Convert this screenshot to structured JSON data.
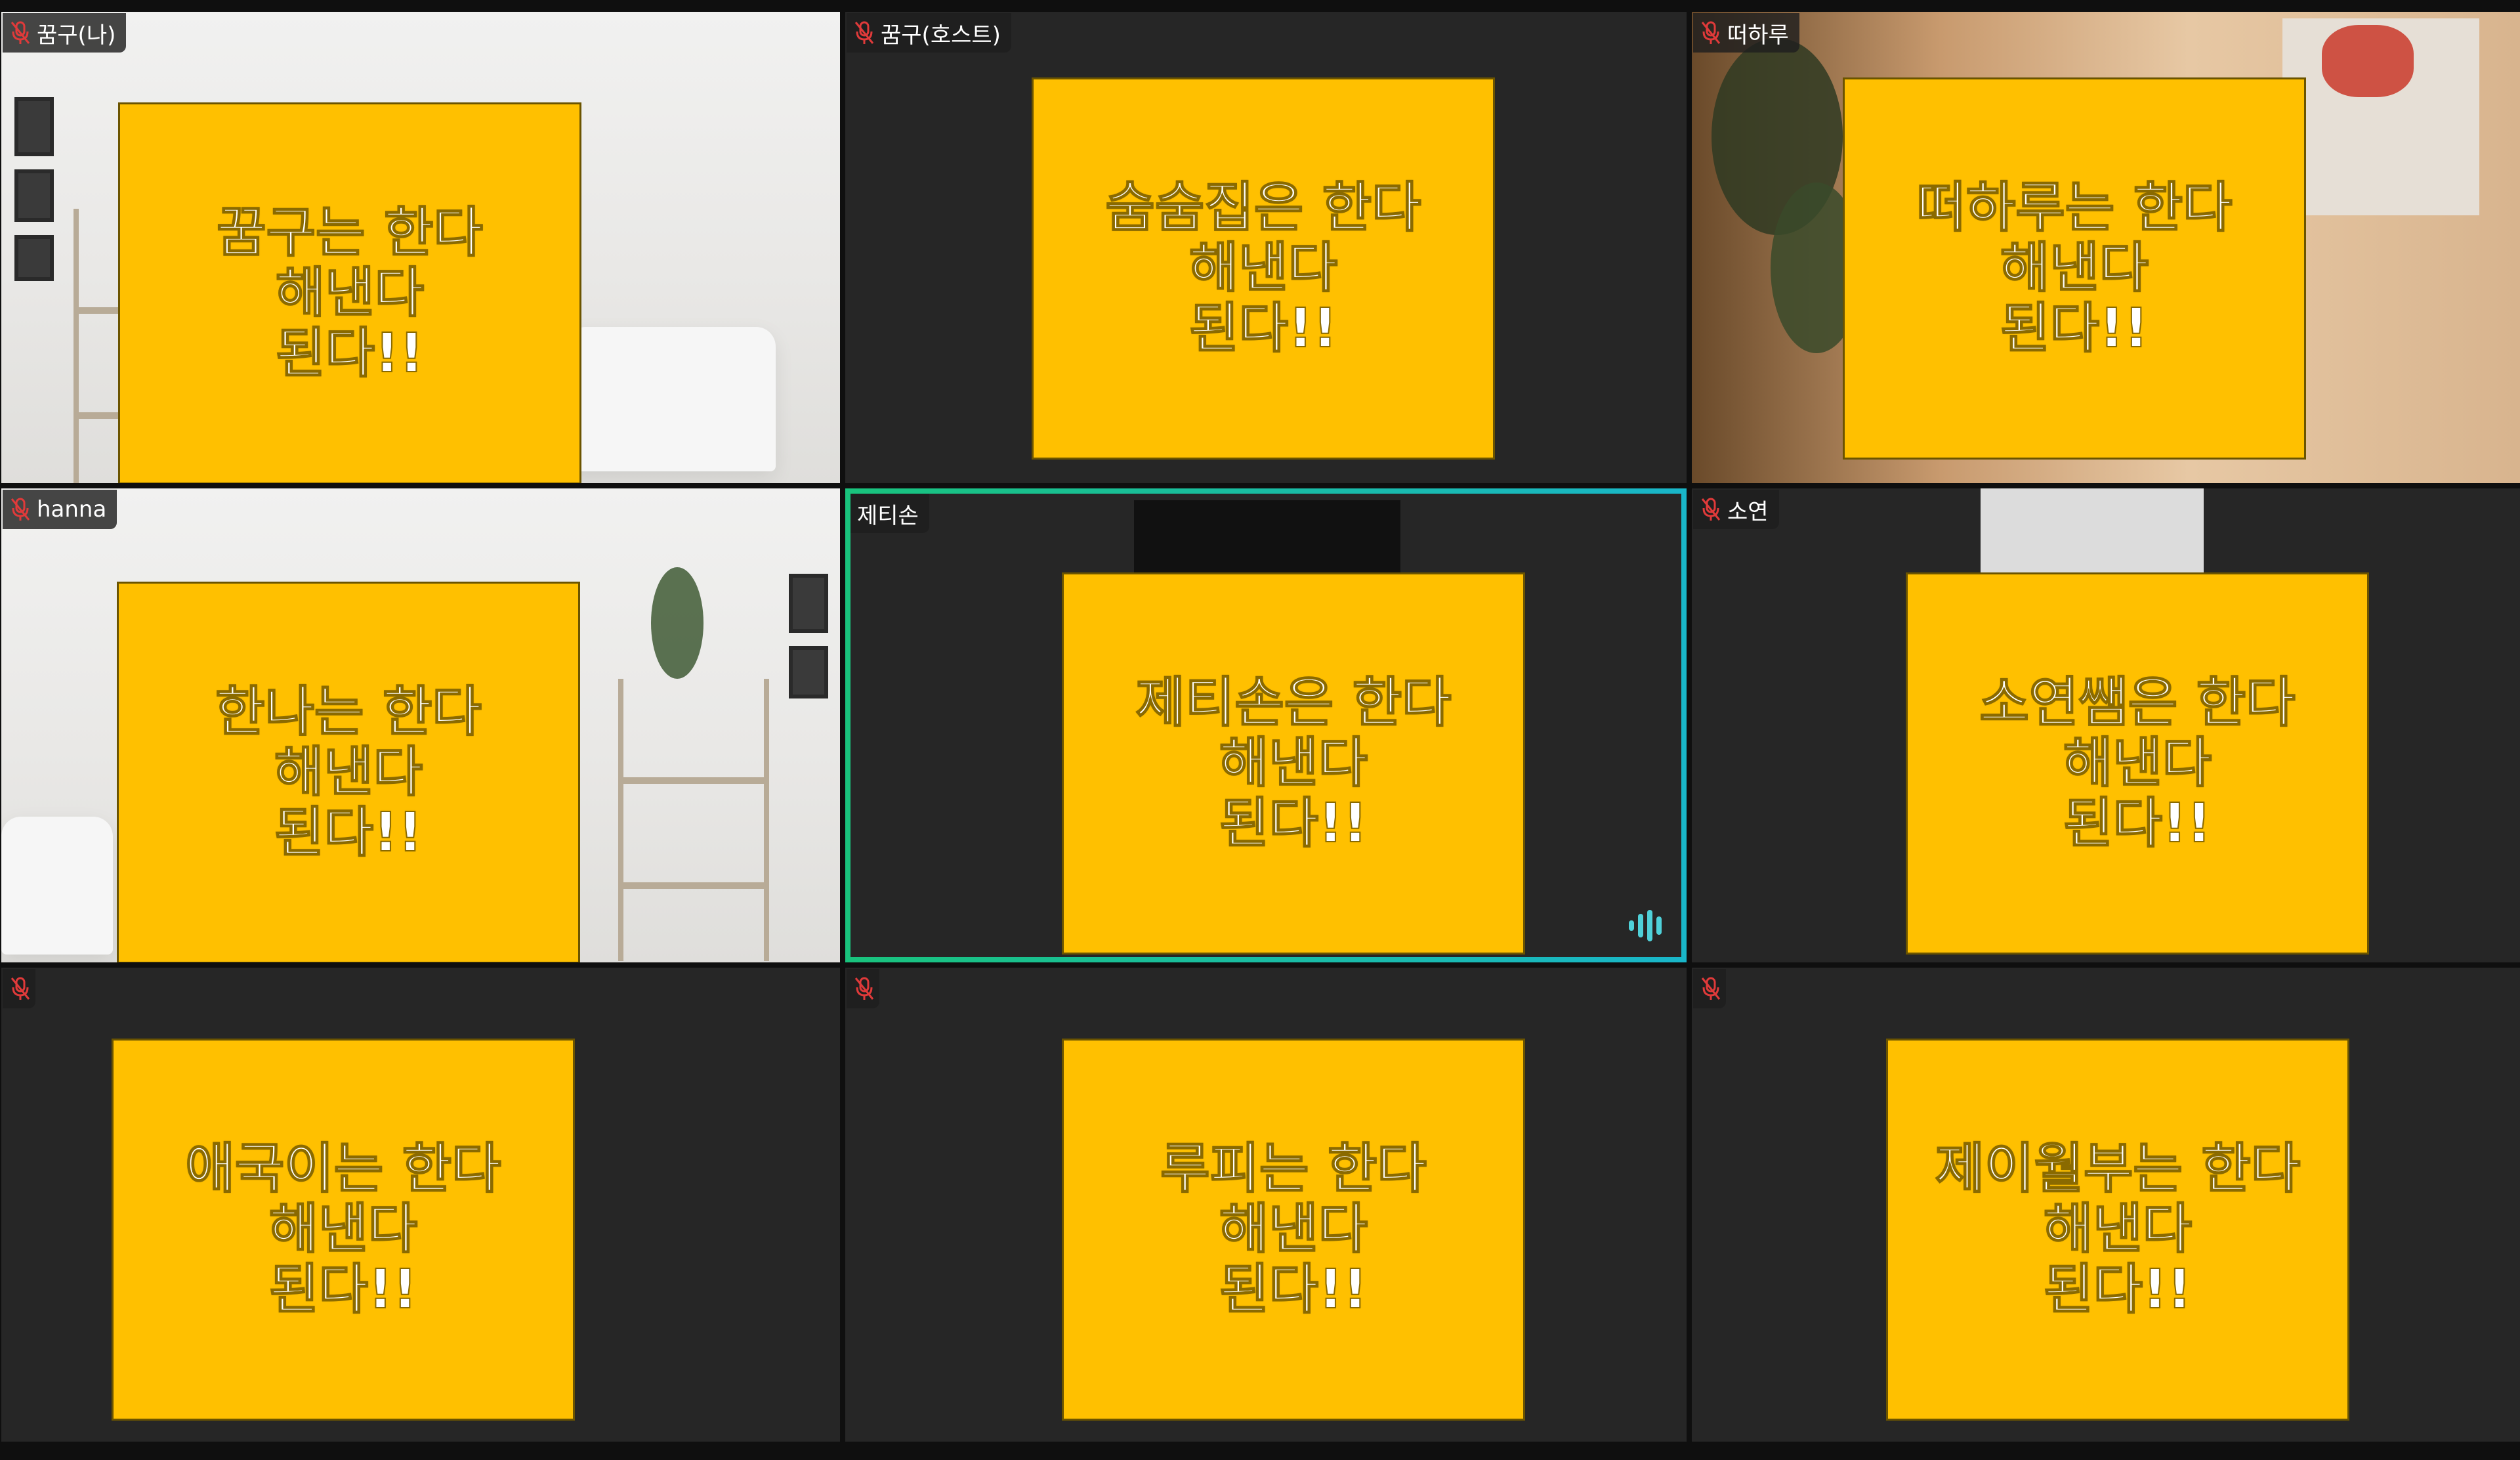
{
  "colors": {
    "sign_background": "#ffc000",
    "sign_text": "#ffffff",
    "tile_background": "#262626",
    "muted_icon": "#e03a3a",
    "active_speaker_border": "#19c37d"
  },
  "tiles": [
    {
      "name": "꿈구(나)",
      "muted": true,
      "sign": [
        "꿈구는 한다",
        "해낸다",
        "된다!!"
      ]
    },
    {
      "name": "꿈구(호스트)",
      "muted": true,
      "sign": [
        "숨숨집은 한다",
        "해낸다",
        "된다!!"
      ]
    },
    {
      "name": "떠하루",
      "muted": true,
      "sign": [
        "떠하루는 한다",
        "해낸다",
        "된다!!"
      ]
    },
    {
      "name": "hanna",
      "muted": true,
      "sign": [
        "한나는 한다",
        "해낸다",
        "된다!!"
      ]
    },
    {
      "name": "제티손",
      "muted": false,
      "active_speaker": true,
      "sign": [
        "제티손은 한다",
        "해낸다",
        "된다!!"
      ]
    },
    {
      "name": "소연",
      "muted": true,
      "sign": [
        "소연쌤은 한다",
        "해낸다",
        "된다!!"
      ]
    },
    {
      "name": "",
      "muted": true,
      "sign": [
        "애국이는 한다",
        "해낸다",
        "된다!!"
      ]
    },
    {
      "name": "",
      "muted": true,
      "sign": [
        "루피는 한다",
        "해낸다",
        "된다!!"
      ]
    },
    {
      "name": "",
      "muted": true,
      "sign": [
        "제이월부는 한다",
        "해낸다",
        "된다!!"
      ]
    }
  ]
}
